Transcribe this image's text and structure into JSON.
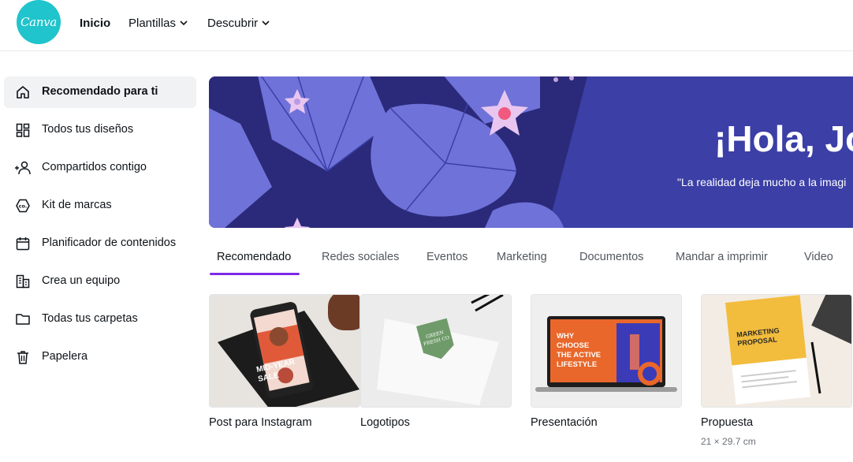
{
  "app": {
    "logo_text": "Canva",
    "brand_color": "#1fc4cc",
    "accent_color": "#7d2ae8"
  },
  "topnav": {
    "home": "Inicio",
    "templates": "Plantillas",
    "discover": "Descubrir"
  },
  "sidebar": {
    "items": [
      {
        "label": "Recomendado para ti",
        "icon": "home-icon"
      },
      {
        "label": "Todos tus diseños",
        "icon": "grid-icon"
      },
      {
        "label": "Compartidos contigo",
        "icon": "shared-users-icon"
      },
      {
        "label": "Kit de marcas",
        "icon": "brand-kit-icon"
      },
      {
        "label": "Planificador de contenidos",
        "icon": "calendar-icon"
      },
      {
        "label": "Crea un equipo",
        "icon": "building-icon"
      },
      {
        "label": "Todas tus carpetas",
        "icon": "folder-icon"
      },
      {
        "label": "Papelera",
        "icon": "trash-icon"
      }
    ]
  },
  "banner": {
    "title": "¡Hola, Jo",
    "subtitle": "\"La realidad deja mucho a la imagi"
  },
  "tabs": [
    "Recomendado",
    "Redes sociales",
    "Eventos",
    "Marketing",
    "Documentos",
    "Mandar a imprimir",
    "Video"
  ],
  "cards": [
    {
      "title": "Post para Instagram",
      "thumb_text": "MID-YEAR SALE"
    },
    {
      "title": "Logotipos",
      "thumb_text": "GREEN FRESH CO"
    },
    {
      "title": "Presentación",
      "thumb_text": "WHY CHOOSE THE ACTIVE LIFESTYLE"
    },
    {
      "title": "Propuesta",
      "subtitle": "21 × 29.7 cm",
      "thumb_text": "MARKETING PROPOSAL"
    }
  ]
}
